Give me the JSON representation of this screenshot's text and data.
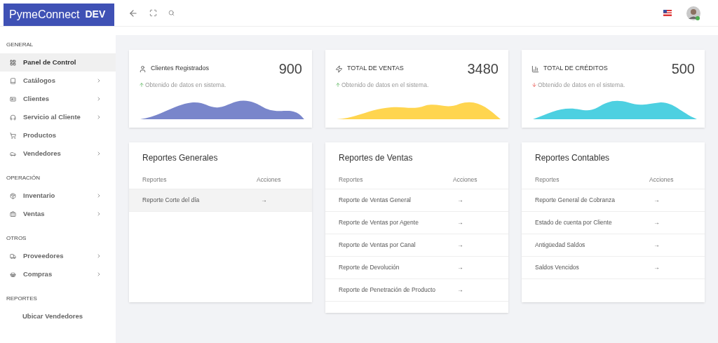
{
  "brand": {
    "name": "PymeConnect",
    "env": "DEV"
  },
  "sidebar": {
    "sections": [
      {
        "title": "GENERAL",
        "items": [
          {
            "label": "Panel de Control",
            "selected": true,
            "expandable": false
          },
          {
            "label": "Catálogos",
            "selected": false,
            "expandable": true
          },
          {
            "label": "Clientes",
            "selected": false,
            "expandable": true
          },
          {
            "label": "Servicio al Cliente",
            "selected": false,
            "expandable": true
          },
          {
            "label": "Productos",
            "selected": false,
            "expandable": false
          },
          {
            "label": "Vendedores",
            "selected": false,
            "expandable": true
          }
        ]
      },
      {
        "title": "OPERACIÓN",
        "items": [
          {
            "label": "Inventario",
            "selected": false,
            "expandable": true
          },
          {
            "label": "Ventas",
            "selected": false,
            "expandable": true
          }
        ]
      },
      {
        "title": "OTROS",
        "items": [
          {
            "label": "Proveedores",
            "selected": false,
            "expandable": true
          },
          {
            "label": "Compras",
            "selected": false,
            "expandable": true
          }
        ]
      },
      {
        "title": "REPORTES",
        "items": [
          {
            "label": "Ubicar Vendedores",
            "selected": false,
            "expandable": false
          }
        ]
      }
    ]
  },
  "stats": [
    {
      "title": "Clientes Registrados",
      "value": "900",
      "rising": true,
      "note": "Obtenido de datos en sistema.",
      "color": "#7986cb"
    },
    {
      "title": "TOTAL DE VENTAS",
      "value": "3480",
      "rising": true,
      "note": "Obtenido de datos en el sistema.",
      "color": "#ffd54f"
    },
    {
      "title": "TOTAL DE CRÉDITOS",
      "value": "500",
      "rising": false,
      "note": "Obtenido de datos en el sistema.",
      "color": "#4dd0e1"
    }
  ],
  "reports": [
    {
      "title": "Reportes Generales",
      "columns": [
        "Reportes",
        "Acciones"
      ],
      "rows": [
        {
          "name": "Reporte Corte del día",
          "action": "→",
          "selected": true
        }
      ]
    },
    {
      "title": "Reportes de Ventas",
      "columns": [
        "Reportes",
        "Acciones"
      ],
      "rows": [
        {
          "name": "Reporte de Ventas General",
          "action": "→",
          "selected": false
        },
        {
          "name": "Reporte de Ventas por Agente",
          "action": "→",
          "selected": false
        },
        {
          "name": "Reporte de Ventas por Canal",
          "action": "→",
          "selected": false
        },
        {
          "name": "Reporte de Devolución",
          "action": "→",
          "selected": false
        },
        {
          "name": "Reporte de Penetración de Producto",
          "action": "→",
          "selected": false
        }
      ]
    },
    {
      "title": "Reportes Contables",
      "columns": [
        "Reportes",
        "Acciones"
      ],
      "rows": [
        {
          "name": "Reporte General de Cobranza",
          "action": "→",
          "selected": false
        },
        {
          "name": "Estado de cuenta por Cliente",
          "action": "→",
          "selected": false
        },
        {
          "name": "Antigüedad Saldos",
          "action": "→",
          "selected": false
        },
        {
          "name": "Saldos Vencidos",
          "action": "→",
          "selected": false
        }
      ]
    }
  ]
}
